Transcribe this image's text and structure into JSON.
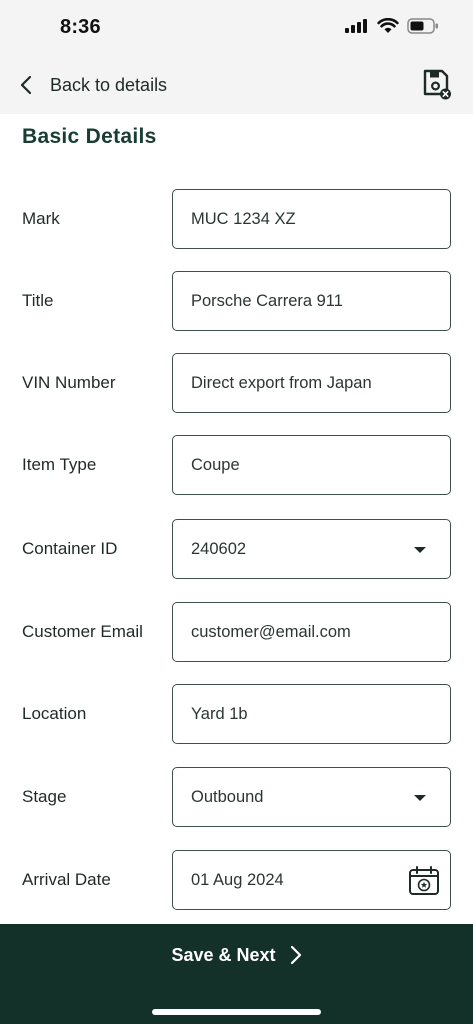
{
  "status_bar": {
    "time": "8:36"
  },
  "nav": {
    "back_label": "Back to details"
  },
  "section": {
    "title": "Basic Details"
  },
  "fields": [
    {
      "label": "Mark",
      "value": "MUC 1234 XZ",
      "kind": "text"
    },
    {
      "label": "Title",
      "value": "Porsche Carrera 911",
      "kind": "text"
    },
    {
      "label": "VIN Number",
      "value": "Direct export from Japan",
      "kind": "text"
    },
    {
      "label": "Item Type",
      "value": "Coupe",
      "kind": "text"
    },
    {
      "label": "Container ID",
      "value": "240602",
      "kind": "select"
    },
    {
      "label": "Customer Email",
      "value": "customer@email.com",
      "kind": "text"
    },
    {
      "label": "Location",
      "value": "Yard 1b",
      "kind": "text"
    },
    {
      "label": "Stage",
      "value": "Outbound",
      "kind": "select"
    },
    {
      "label": "Arrival Date",
      "value": "01 Aug 2024",
      "kind": "date"
    }
  ],
  "footer": {
    "save_next_label": "Save & Next"
  },
  "icons": {
    "back": "chevron-left-icon",
    "save": "floppy-disk-icon",
    "dropdown": "caret-down-icon",
    "calendar": "calendar-icon",
    "next": "chevron-right-icon"
  },
  "colors": {
    "brand_dark": "#143129",
    "title": "#183d33",
    "border": "#3f4f4a",
    "header_bg": "#f3f4f3"
  }
}
